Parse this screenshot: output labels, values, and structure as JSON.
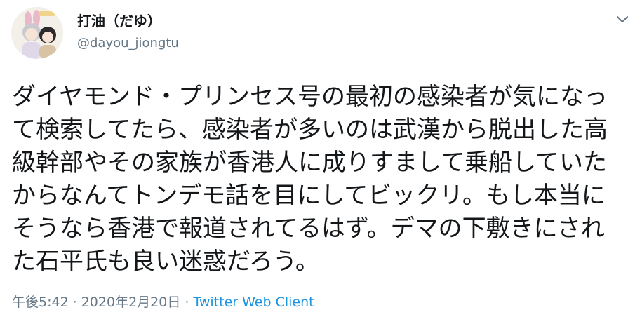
{
  "user": {
    "display_name": "打油（だゆ）",
    "handle": "@dayou_jiongtu",
    "avatar_icon": "profile-avatar"
  },
  "tweet": {
    "text": "ダイヤモンド・プリンセス号の最初の感染者が気になって検索してたら、感染者が多いのは武漢から脱出した高級幹部やその家族が香港人に成りすまして乗船していたからなんてトンデモ話を目にしてビックリ。もし本当にそうなら香港で報道されてるはず。デマの下敷きにされた石平氏も良い迷惑だろう。",
    "time": "午後5:42",
    "date": "2020年2月20日",
    "separator": "·",
    "client": "Twitter Web Client"
  },
  "colors": {
    "text": "#14171a",
    "muted": "#657786",
    "link": "#1b95e0"
  },
  "icons": {
    "menu": "chevron-down-icon"
  }
}
